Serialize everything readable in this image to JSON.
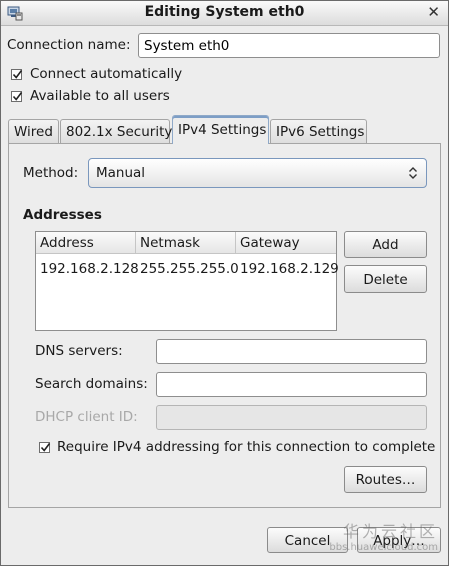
{
  "window": {
    "title": "Editing System eth0"
  },
  "connection": {
    "name_label": "Connection name:",
    "name_value": "System eth0"
  },
  "options": {
    "connect_auto": "Connect automatically",
    "all_users": "Available to all users"
  },
  "tabs": [
    {
      "label": "Wired"
    },
    {
      "label": "802.1x Security"
    },
    {
      "label": "IPv4 Settings"
    },
    {
      "label": "IPv6 Settings"
    }
  ],
  "ipv4": {
    "method_label": "Method:",
    "method_value": "Manual",
    "addresses_heading": "Addresses",
    "columns": [
      "Address",
      "Netmask",
      "Gateway"
    ],
    "rows": [
      [
        "192.168.2.128",
        "255.255.255.0",
        "192.168.2.129"
      ]
    ],
    "add_label": "Add",
    "delete_label": "Delete",
    "dns_label": "DNS servers:",
    "search_label": "Search domains:",
    "dhcp_label": "DHCP client ID:",
    "require_label": "Require IPv4 addressing for this connection to complete",
    "routes_label": "Routes…"
  },
  "footer": {
    "cancel_label": "Cancel",
    "apply_label": "Apply…"
  },
  "watermark": {
    "line1": "华为云社区",
    "line2": "bbs.huaweicloud.com"
  }
}
